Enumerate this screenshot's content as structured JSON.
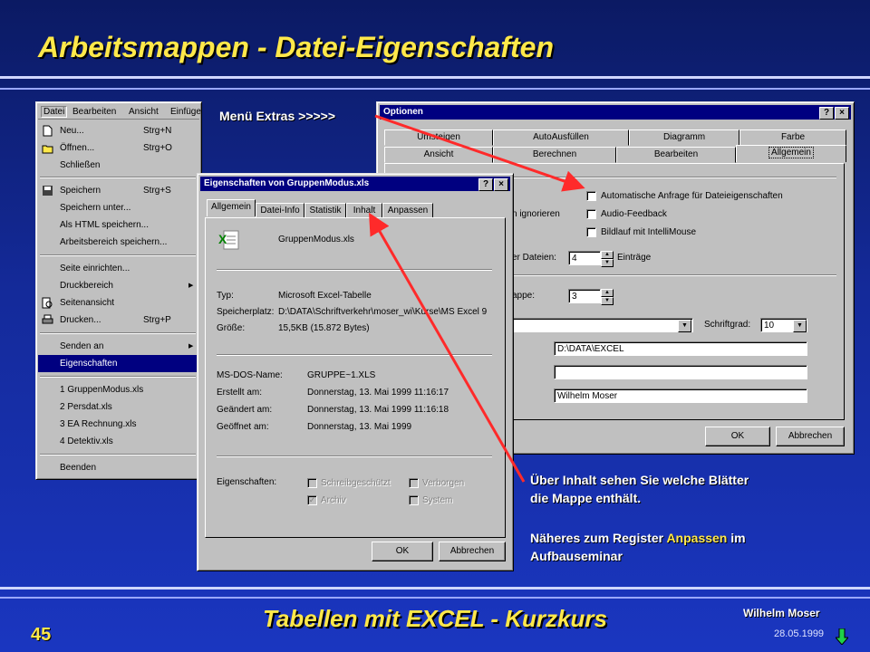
{
  "slide": {
    "title": "Arbeitsmappen - Datei-Eigenschaften",
    "footer_title": "Tabellen mit EXCEL - Kurzkurs",
    "page_number": "45",
    "author": "Wilhelm  Moser",
    "date": "28.05.1999",
    "menu_hint": "Menü Extras >>>>>",
    "note1_line1": "Über Inhalt sehen Sie welche Blätter",
    "note1_line2": "die Mappe enthält.",
    "note2_line1_a": "Näheres zum Register ",
    "note2_line1_hl": "Anpassen",
    "note2_line1_b": " im",
    "note2_line2": "Aufbauseminar",
    "colors": {
      "title": "#ffe84a",
      "arrow": "#ff2a2a",
      "background": "#142a9a"
    }
  },
  "menubar": [
    "Datei",
    "Bearbeiten",
    "Ansicht",
    "Einfüge"
  ],
  "file_menu": [
    {
      "label": "Neu...",
      "shortcut": "Strg+N",
      "icon": "new-document-icon"
    },
    {
      "label": "Öffnen...",
      "shortcut": "Strg+O",
      "icon": "open-folder-icon"
    },
    {
      "label": "Schließen",
      "shortcut": ""
    },
    {
      "label": "Speichern",
      "shortcut": "Strg+S",
      "icon": "save-disk-icon"
    },
    {
      "label": "Speichern unter...",
      "shortcut": ""
    },
    {
      "label": "Als HTML speichern...",
      "shortcut": ""
    },
    {
      "label": "Arbeitsbereich speichern...",
      "shortcut": ""
    },
    {
      "label": "Seite einrichten...",
      "shortcut": ""
    },
    {
      "label": "Druckbereich",
      "shortcut": "",
      "submenu": true
    },
    {
      "label": "Seitenansicht",
      "shortcut": "",
      "icon": "print-preview-icon"
    },
    {
      "label": "Drucken...",
      "shortcut": "Strg+P",
      "icon": "printer-icon"
    },
    {
      "label": "Senden an",
      "shortcut": "",
      "submenu": true
    },
    {
      "label": "Eigenschaften",
      "shortcut": "",
      "highlighted": true
    },
    {
      "label": "1 GruppenModus.xls",
      "shortcut": ""
    },
    {
      "label": "2 Persdat.xls",
      "shortcut": ""
    },
    {
      "label": "3 EA Rechnung.xls",
      "shortcut": ""
    },
    {
      "label": "4 Detektiv.xls",
      "shortcut": ""
    },
    {
      "label": "Beenden",
      "shortcut": ""
    }
  ],
  "optionen": {
    "title": "Optionen",
    "help": "?",
    "close": "×",
    "tabs_back": [
      "Umsteigen",
      "AutoAusfüllen",
      "Diagramm",
      "Farbe"
    ],
    "tabs_front": [
      "Ansicht",
      "Berechnen",
      "Bearbeiten",
      "Allgemein"
    ],
    "checkboxes": [
      "Automatische Anfrage für Dateieigenschaften",
      "Audio-Feedback",
      "Bildlauf mit IntelliMouse"
    ],
    "ignore_label": "n ignorieren",
    "recent_label": "er Dateien:",
    "recent_value": "4",
    "recent_unit": "Einträge",
    "sheets_label": "appe:",
    "sheets_value": "3",
    "fontsize_label": "Schriftgrad:",
    "fontsize_value": "10",
    "path_value": "D:\\DATA\\EXCEL",
    "start_value": "",
    "username_value": "Wilhelm Moser",
    "ok": "OK",
    "cancel": "Abbrechen"
  },
  "props": {
    "title": "Eigenschaften von GruppenModus.xls",
    "help": "?",
    "close": "×",
    "tabs": [
      "Allgemein",
      "Datei-Info",
      "Statistik",
      "Inhalt",
      "Anpassen"
    ],
    "filename": "GruppenModus.xls",
    "rows1": [
      {
        "label": "Typ:",
        "value": "Microsoft Excel-Tabelle"
      },
      {
        "label": "Speicherplatz:",
        "value": "D:\\DATA\\Schriftverkehr\\moser_wi\\Kurse\\MS Excel 9"
      },
      {
        "label": "Größe:",
        "value": "15,5KB (15.872 Bytes)"
      }
    ],
    "rows2": [
      {
        "label": "MS-DOS-Name:",
        "value": "GRUPPE~1.XLS"
      },
      {
        "label": "Erstellt am:",
        "value": "Donnerstag, 13. Mai 1999 11:16:17"
      },
      {
        "label": "Geändert am:",
        "value": "Donnerstag, 13. Mai 1999 11:16:18"
      },
      {
        "label": "Geöffnet am:",
        "value": "Donnerstag, 13. Mai 1999"
      }
    ],
    "attributes_label": "Eigenschaften:",
    "attributes": [
      "Schreibgeschützt",
      "Verborgen",
      "Archiv",
      "System"
    ],
    "ok": "OK",
    "cancel": "Abbrechen"
  }
}
